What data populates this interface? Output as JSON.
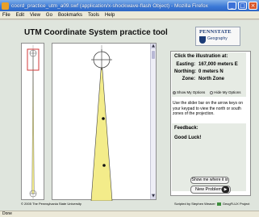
{
  "window": {
    "title": "coord_practice_utm_a09.swf (application/x-shockwave-flash Object) - Mozilla Firefox",
    "minimize": "_",
    "maximize": "□",
    "close": "×"
  },
  "menu": [
    "File",
    "Edit",
    "View",
    "Go",
    "Bookmarks",
    "Tools",
    "Help"
  ],
  "app": {
    "title": "UTM Coordinate System practice tool",
    "logo_line1": "PENNSTATE",
    "logo_line2": "Geography"
  },
  "info": {
    "heading": "Click the illustration at:",
    "easting_label": "Easting:",
    "easting_value": "167,000 meters E",
    "northing_label": "Northing:",
    "northing_value": "0 meters N",
    "zone_label": "Zone:",
    "zone_value": "North Zone"
  },
  "options": {
    "show": "Show My Options",
    "hide": "Hide My Options",
    "selected": "show"
  },
  "instructions": "Use the slider bar on the arrow keys on your keypad to view the north or south zones of the projection.",
  "feedback": {
    "label": "Feedback:",
    "message": "Good Luck!"
  },
  "buttons": {
    "show_where": "Show me where it is",
    "new_problem": "New Problem",
    "arrow": "▶"
  },
  "footer": {
    "copyright": "© 2005 The Pennsylvania State University",
    "credit": "Scripted by Stephen Weaver",
    "project": "GeogFLUX Project"
  },
  "status": "Done",
  "colors": {
    "zone_fill": "#f3ec8a",
    "locator_box": "#d23a3a",
    "titlebar": "#2f66c4"
  }
}
